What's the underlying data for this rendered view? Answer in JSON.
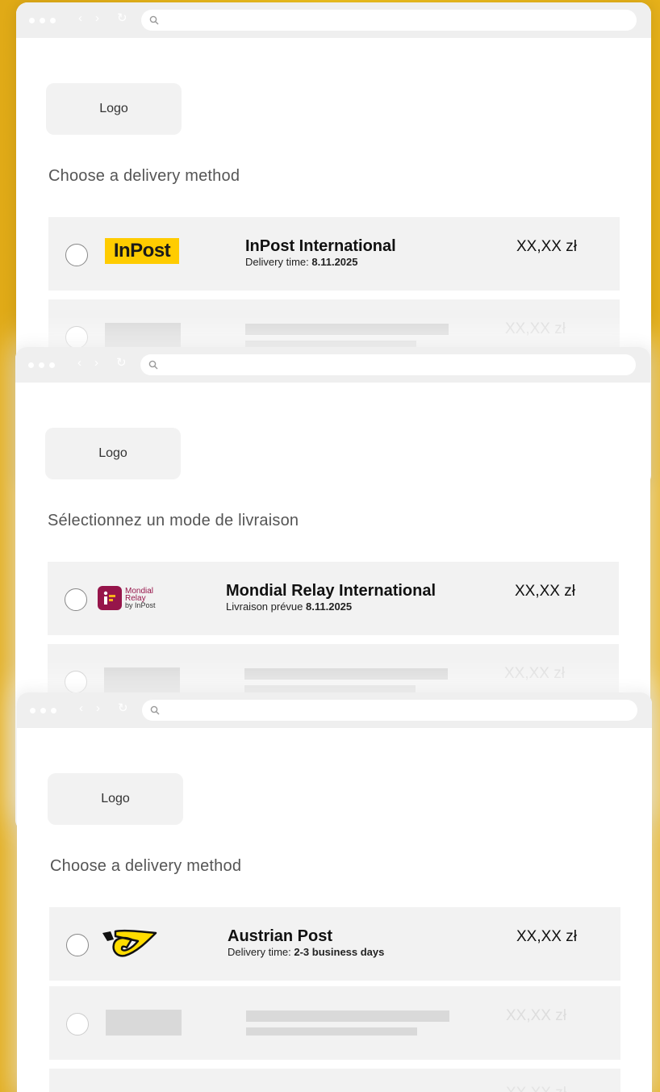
{
  "colors": {
    "background": "#f1c21f",
    "inpost_yellow": "#ffcc00",
    "mondial_red": "#96154a",
    "austrian_post_yellow": "#ffdc00"
  },
  "windows": [
    {
      "logo_label": "Logo",
      "heading": "Choose a delivery method",
      "carrier": {
        "logo_text": "InPost",
        "name": "InPost International",
        "sub_label": "Delivery time:",
        "sub_value": "8.11.2025",
        "price": "XX,XX zł"
      },
      "placeholder_price": "XX,XX zł"
    },
    {
      "logo_label": "Logo",
      "heading": "Sélectionnez un mode de livraison",
      "carrier": {
        "logo_text_1": "Mondial",
        "logo_text_2": "Relay",
        "logo_text_3": "by InPost",
        "name": "Mondial Relay International",
        "sub_label": "Livraison prévue",
        "sub_value": "8.11.2025",
        "price": "XX,XX zł"
      },
      "placeholder_price": "XX,XX zł"
    },
    {
      "logo_label": "Logo",
      "heading": "Choose a delivery method",
      "carrier": {
        "name": "Austrian Post",
        "sub_label": "Delivery time:",
        "sub_value": "2-3 business days",
        "price": "XX,XX zł"
      },
      "placeholder_price": "XX,XX zł",
      "placeholder_price_2": "XX,XX zł"
    }
  ],
  "icons": {
    "nav_back": "‹",
    "nav_forward": "›",
    "reload": "↻",
    "search": "search-icon"
  }
}
